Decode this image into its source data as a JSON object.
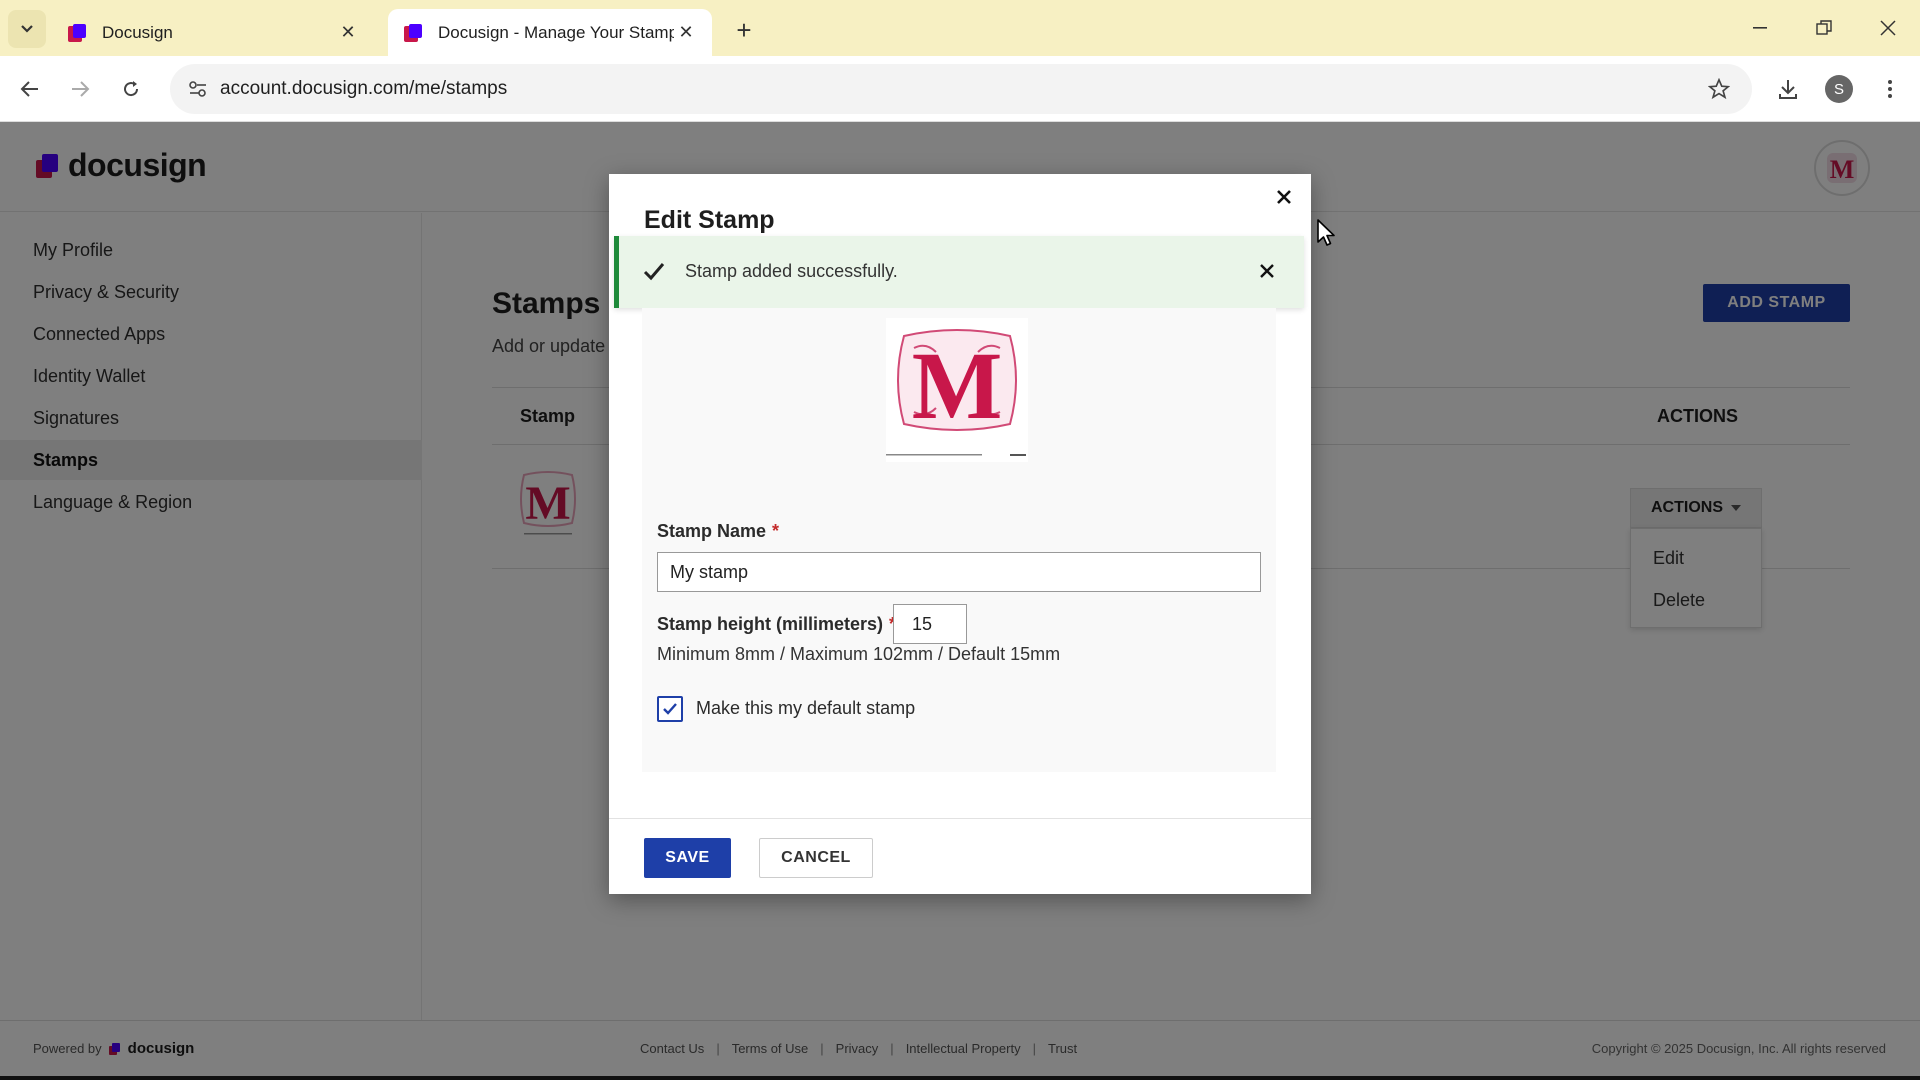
{
  "browser": {
    "tabs": [
      {
        "title": "Docusign",
        "active": false
      },
      {
        "title": "Docusign - Manage Your Stamps",
        "active": true
      }
    ],
    "url": "account.docusign.com/me/stamps",
    "profile_initial": "S"
  },
  "header": {
    "logo_text": "docusign",
    "avatar_letter": "M"
  },
  "sidebar": {
    "items": [
      {
        "label": "My Profile",
        "active": false
      },
      {
        "label": "Privacy & Security",
        "active": false
      },
      {
        "label": "Connected Apps",
        "active": false
      },
      {
        "label": "Identity Wallet",
        "active": false
      },
      {
        "label": "Signatures",
        "active": false
      },
      {
        "label": "Stamps",
        "active": true
      },
      {
        "label": "Language & Region",
        "active": false
      }
    ]
  },
  "content": {
    "title": "Stamps",
    "subtitle": "Add or update",
    "add_stamp_label": "ADD STAMP",
    "table": {
      "col_stamp": "Stamp",
      "col_actions": "ACTIONS"
    },
    "actions_button": "ACTIONS",
    "actions_menu": [
      "Edit",
      "Delete"
    ]
  },
  "modal": {
    "title": "Edit Stamp",
    "toast_message": "Stamp added successfully.",
    "stamp_name_label": "Stamp Name",
    "stamp_name_value": "My stamp",
    "stamp_height_label": "Stamp height (millimeters)",
    "stamp_height_value": "15",
    "height_hint": "Minimum 8mm / Maximum 102mm / Default 15mm",
    "default_checkbox_label": "Make this my default stamp",
    "default_checked": true,
    "save_label": "SAVE",
    "cancel_label": "CANCEL"
  },
  "footer": {
    "powered_by": "Powered by",
    "powered_logo": "docusign",
    "links": [
      "Contact Us",
      "Terms of Use",
      "Privacy",
      "Intellectual Property",
      "Trust"
    ],
    "copyright": "Copyright © 2025 Docusign, Inc. All rights reserved"
  },
  "colors": {
    "brand_blue": "#1e3fa8",
    "success_green": "#1e8a3a",
    "stamp_red": "#c8174a",
    "logo_purple": "#4c00ff"
  }
}
